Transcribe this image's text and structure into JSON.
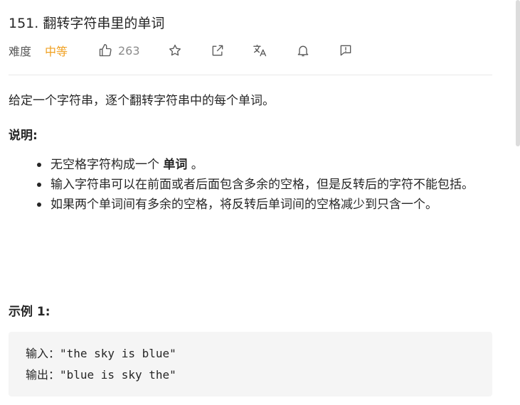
{
  "problem": {
    "title": "151. 翻转字符串里的单词",
    "difficulty_label": "难度",
    "difficulty_value": "中等",
    "likes": "263",
    "difficulty_color": "#f0a020"
  },
  "toolbar": {
    "icons": [
      "thumbs-up-icon",
      "star-icon",
      "share-icon",
      "translate-icon",
      "bell-icon",
      "feedback-icon"
    ]
  },
  "description": "给定一个字符串，逐个翻转字符串中的每个单词。",
  "notes": {
    "heading": "说明:",
    "items": [
      {
        "before": "无空格字符构成一个 ",
        "bold": "单词",
        "after": " 。"
      },
      {
        "text": "输入字符串可以在前面或者后面包含多余的空格，但是反转后的字符不能包括。"
      },
      {
        "text": "如果两个单词间有多余的空格，将反转后单词间的空格减少到只含一个。"
      }
    ]
  },
  "example": {
    "heading": "示例 1:",
    "input_line": "输入：\"the sky is blue\"",
    "output_line": "输出：\"blue is sky the\""
  }
}
